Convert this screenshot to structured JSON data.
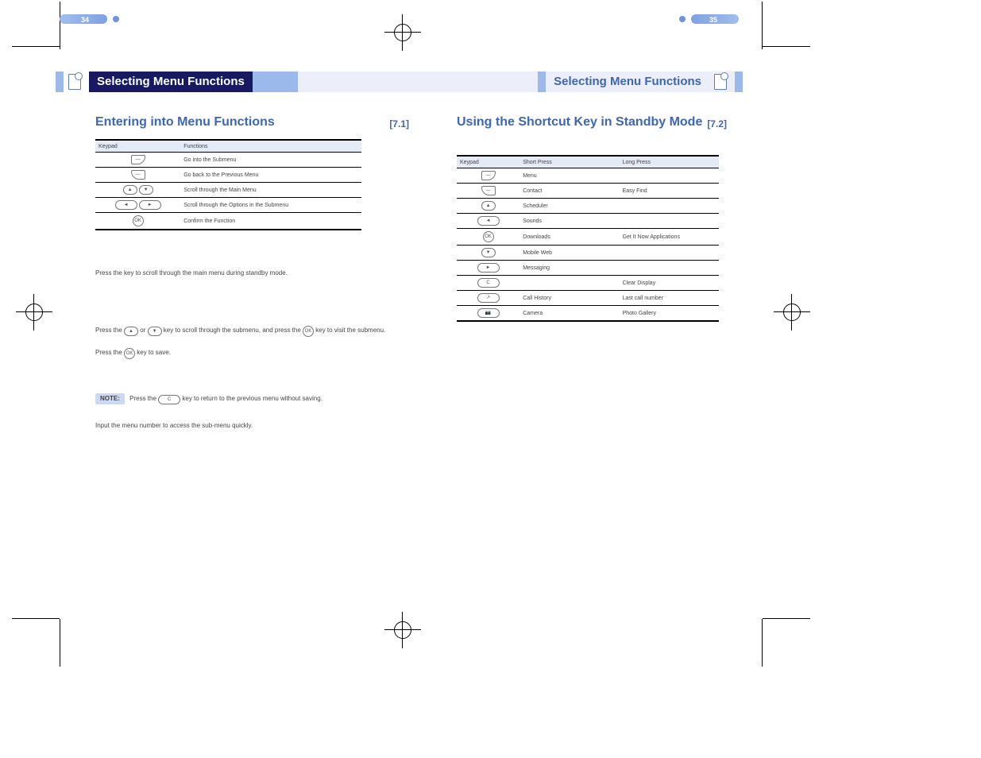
{
  "headers": {
    "left_tab": "Selecting Menu Functions",
    "right_tab": "Selecting Menu Functions"
  },
  "left": {
    "section_title": "Entering into Menu Functions",
    "section_num": "[7.1]",
    "table": {
      "h1": "Keypad",
      "h2": "Functions",
      "rows": [
        {
          "key": "soft-left",
          "fn": "Go into the Submenu"
        },
        {
          "key": "soft-right",
          "fn": "Go back to the Previous Menu"
        },
        {
          "key": "updown",
          "fn": "Scroll through the Main Menu"
        },
        {
          "key": "leftright",
          "fn": "Scroll through the Options in the Submenu"
        },
        {
          "key": "ok",
          "fn": "Confirm the Function"
        }
      ]
    },
    "para1": "Press the       key to scroll through the main menu during standby mode.",
    "para2a": "Press the   or   key to scroll through the submenu, and press the   key to visit the submenu.",
    "para2b": "Press the   key to save.",
    "note_label": "NOTE:",
    "note_text": "Press the   key to return to the previous menu without saving.",
    "para3": "Input the menu number to access the sub-menu quickly.",
    "page_num": "34"
  },
  "right": {
    "section_title": "Using the Shortcut Key in Standby Mode",
    "section_num": "[7.2]",
    "table": {
      "h1": "Keypad",
      "h2": "Short Press",
      "h3": "Long Press",
      "rows": [
        {
          "key": "soft-left",
          "a": "Menu",
          "b": ""
        },
        {
          "key": "soft-right",
          "a": "Contact",
          "b": "Easy Find"
        },
        {
          "key": "up",
          "a": "Scheduler",
          "b": ""
        },
        {
          "key": "left",
          "a": "Sounds",
          "b": ""
        },
        {
          "key": "ok",
          "a": "Downloads",
          "b": "Get It Now Applications"
        },
        {
          "key": "down",
          "a": "Mobile Web",
          "b": ""
        },
        {
          "key": "right",
          "a": "Messaging",
          "b": ""
        },
        {
          "key": "clr",
          "a": "",
          "b": "Clear Display"
        },
        {
          "key": "send",
          "a": "Call History",
          "b": "Last call number"
        },
        {
          "key": "camera",
          "a": "Camera",
          "b": "Photo Gallery"
        }
      ]
    },
    "page_num": "35"
  },
  "icons": {
    "soft-left": "⌐",
    "soft-right": "¬",
    "up": "▲",
    "down": "▼",
    "left": "◄",
    "right": "►",
    "ok": "OK",
    "clr": "C",
    "send": "↗",
    "camera": "📷"
  }
}
